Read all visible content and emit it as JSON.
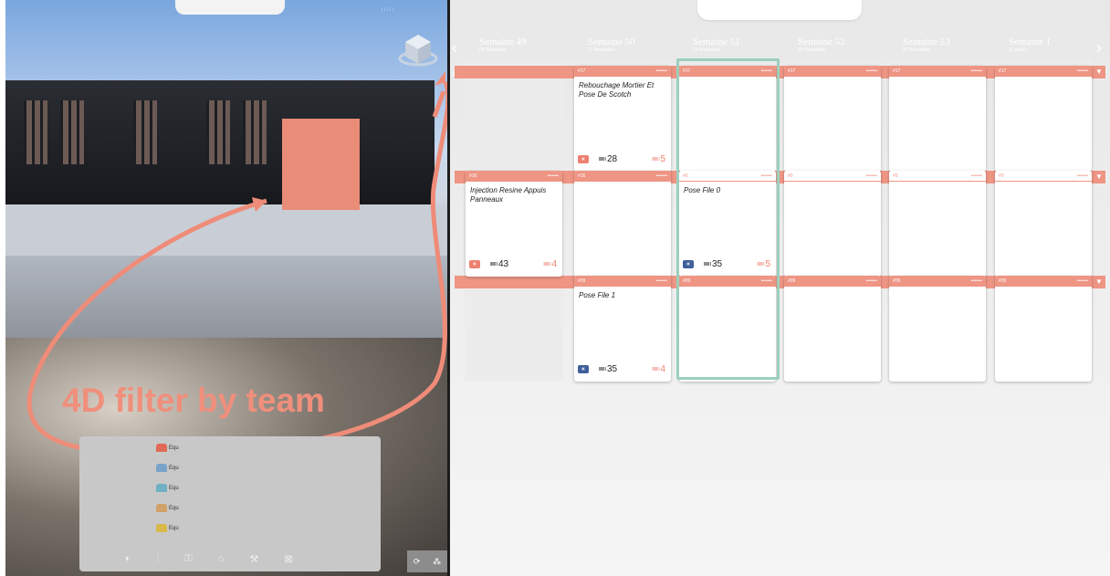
{
  "left_view": {
    "annotation": "4D filter by team",
    "teams": [
      {
        "label": "Equ",
        "color": "#e06a55"
      },
      {
        "label": "Equ",
        "color": "#7aa3c9"
      },
      {
        "label": "Equ",
        "color": "#6fb0c2"
      },
      {
        "label": "Equ",
        "color": "#d1a16a"
      },
      {
        "label": "Equ",
        "color": "#d8b94a"
      }
    ],
    "bottom_tools": [
      "color-wheel-icon",
      "filter-icon",
      "lock-icon",
      "house-icon",
      "worker-icon",
      "area-icon"
    ]
  },
  "planning": {
    "weeks": [
      {
        "title": "Semaine 49",
        "sub": "08 Novembre"
      },
      {
        "title": "Semaine 50",
        "sub": "11 Novembre"
      },
      {
        "title": "Semaine 51",
        "sub": "15 Novembre"
      },
      {
        "title": "Semaine 52",
        "sub": "22 Novembre"
      },
      {
        "title": "Semaine 53",
        "sub": "27 Novembre"
      },
      {
        "title": "Semaine 1",
        "sub": "3 Janvier"
      }
    ],
    "band_tag": "STA",
    "rows": [
      [
        null,
        {
          "code": "#17",
          "title": "Rebouchage Mortier Et Pose De Scotch",
          "badge": "red",
          "duration": "28",
          "qty": "5"
        },
        {
          "code": "#17",
          "title": ""
        },
        {
          "code": "#17",
          "title": ""
        },
        {
          "code": "#17",
          "title": ""
        },
        {
          "code": "#17",
          "title": ""
        }
      ],
      [
        {
          "code": "#16",
          "title": "Injection Resine Appuis Panneaux",
          "badge": "red",
          "duration": "43",
          "qty": "4"
        },
        {
          "code": "#16",
          "title": ""
        },
        {
          "code": "#0",
          "title": "Pose File 0",
          "badge": "blue",
          "duration": "35",
          "qty": "5",
          "light": true
        },
        {
          "code": "#0",
          "title": "",
          "light": true
        },
        {
          "code": "#0",
          "title": "",
          "light": true
        },
        {
          "code": "#0",
          "title": "",
          "light": true
        }
      ],
      [
        null,
        {
          "code": "#09",
          "title": "Pose File 1",
          "badge": "blue",
          "duration": "35",
          "qty": "4"
        },
        {
          "code": "#09",
          "title": ""
        },
        {
          "code": "#09",
          "title": ""
        },
        {
          "code": "#09",
          "title": ""
        },
        {
          "code": "#09",
          "title": ""
        }
      ]
    ]
  }
}
